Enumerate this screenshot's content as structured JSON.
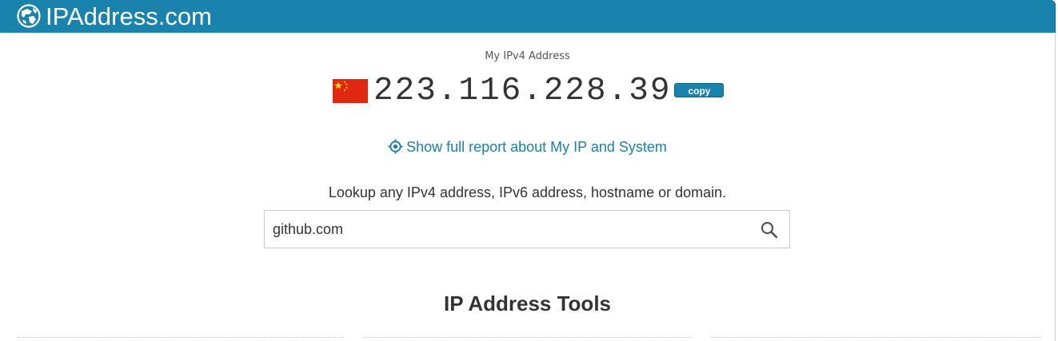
{
  "header": {
    "logo_text": "IPAddress.com",
    "logo_icon": "globe-icon",
    "background_color": "#1a83ad"
  },
  "ip": {
    "label": "My IPv4 Address",
    "value": "223.116.228.39",
    "country_flag": "china-flag-icon",
    "copy_label": "copy"
  },
  "report": {
    "icon": "target-icon",
    "link_text": "Show full report about My IP and System"
  },
  "lookup": {
    "instruction": "Lookup any IPv4 address, IPv6 address, hostname or domain.",
    "input_value": "github.com",
    "search_icon": "search-icon"
  },
  "tools": {
    "heading": "IP Address Tools"
  }
}
